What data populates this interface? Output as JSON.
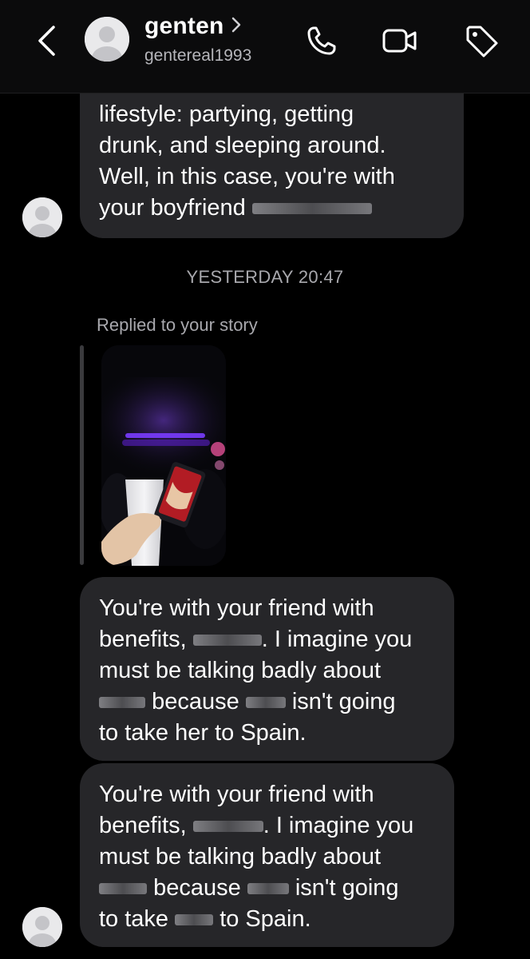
{
  "header": {
    "display_name": "genten",
    "username": "gentereal1993"
  },
  "messages": [
    {
      "sender": "them",
      "lines": [
        "lifestyle: partying, getting",
        "drunk, and sleeping around.",
        "Well, in this case, you're with",
        "your boyfriend"
      ]
    },
    {
      "sender": "them",
      "lines": [
        "You're with your friend with",
        "benefits,",
        ". I imagine you",
        "must be talking badly about",
        "because",
        "isn't going",
        "to take her to Spain."
      ]
    },
    {
      "sender": "them",
      "lines": [
        "You're with your friend with",
        "benefits,",
        ". I imagine you",
        "must be talking badly about",
        "because",
        "isn't going",
        "to take",
        "to Spain."
      ]
    }
  ],
  "timestamp": "YESTERDAY 20:47",
  "story_reply_label": "Replied to your story",
  "colors": {
    "background": "#000000",
    "bubble": "#262629",
    "secondary_text": "#a8a8ad"
  },
  "icons": [
    "back-chevron-icon",
    "avatar-placeholder-icon",
    "chevron-right-icon",
    "phone-icon",
    "video-camera-icon",
    "tag-icon"
  ]
}
